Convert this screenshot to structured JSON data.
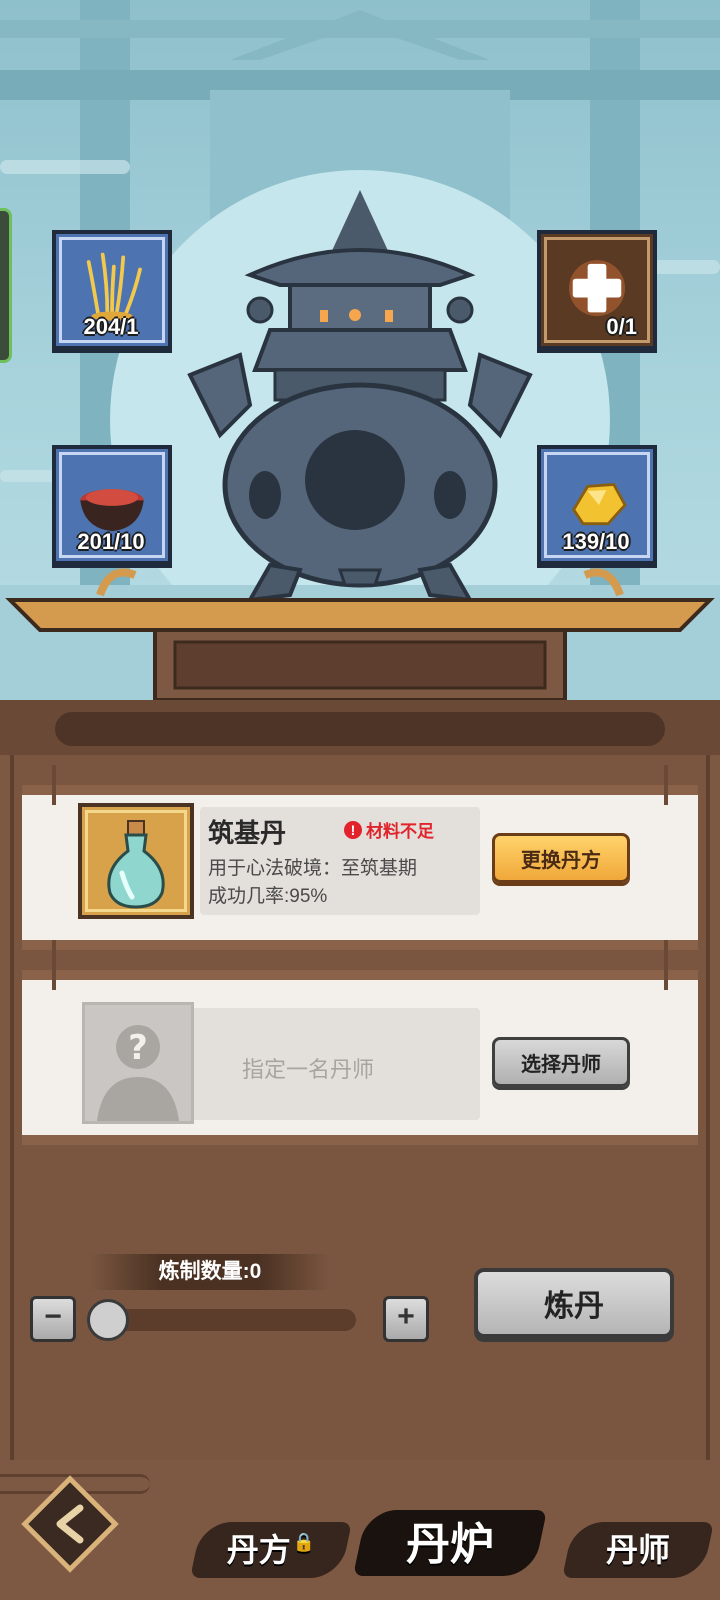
{
  "materials": [
    {
      "id": "herb",
      "count": "204/1"
    },
    {
      "id": "add",
      "count": "0/1"
    },
    {
      "id": "powder",
      "count": "201/10"
    },
    {
      "id": "gold",
      "count": "139/10"
    }
  ],
  "recipe": {
    "name": "筑基丹",
    "warning": "材料不足",
    "usage": "用于心法破境：至筑基期",
    "success_rate": "成功几率:95%",
    "change_button": "更换丹方"
  },
  "alchemist": {
    "placeholder": "指定一名丹师",
    "select_button": "选择丹师"
  },
  "quantity": {
    "label": "炼制数量:0",
    "minus": "−",
    "plus": "+",
    "value": 0
  },
  "refine_button": "炼丹",
  "nav": {
    "tabs": [
      {
        "label": "丹方",
        "locked": true
      },
      {
        "label": "丹炉",
        "active": true
      },
      {
        "label": "丹师"
      }
    ]
  },
  "colors": {
    "panel": "#7d5943",
    "warning": "#e1242b",
    "gold_button": "#f0a83a"
  }
}
